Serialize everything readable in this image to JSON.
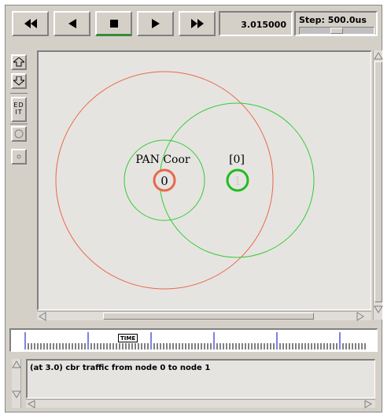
{
  "toolbar": {
    "buttons": [
      {
        "name": "rewind",
        "icon": "rewind-icon"
      },
      {
        "name": "back",
        "icon": "play-backward-icon"
      },
      {
        "name": "stop",
        "icon": "stop-icon"
      },
      {
        "name": "play",
        "icon": "play-forward-icon"
      },
      {
        "name": "fast-forward",
        "icon": "fast-forward-icon"
      }
    ],
    "active_button": "stop",
    "active_color": "#3a8a3a",
    "time_value": "3.015000",
    "step_label": "Step: 500.0us",
    "step_slider_level": 0.5
  },
  "side_tools": {
    "zoom_in_icon": "zoom-in-icon",
    "zoom_out_icon": "zoom-out-icon",
    "edit_label_line1": "ED",
    "edit_label_line2": "IT",
    "node_tool_icon": "circle-icon",
    "point_tool_icon": "dot-icon"
  },
  "canvas": {
    "background": "#e6e4e1",
    "node_labels": {
      "n0_label": "PAN Coor",
      "n0_id": "0",
      "n1_label": "[0]",
      "n1_id": "1"
    },
    "colors": {
      "node0": "#e8684a",
      "node1": "#22bb22",
      "range_red": "#e8684a",
      "range_green": "#33cc33"
    }
  },
  "timeline": {
    "marker_label": "TIME"
  },
  "messages": {
    "lines": [
      "(at 3.0) cbr traffic from node 0 to node 1"
    ]
  }
}
